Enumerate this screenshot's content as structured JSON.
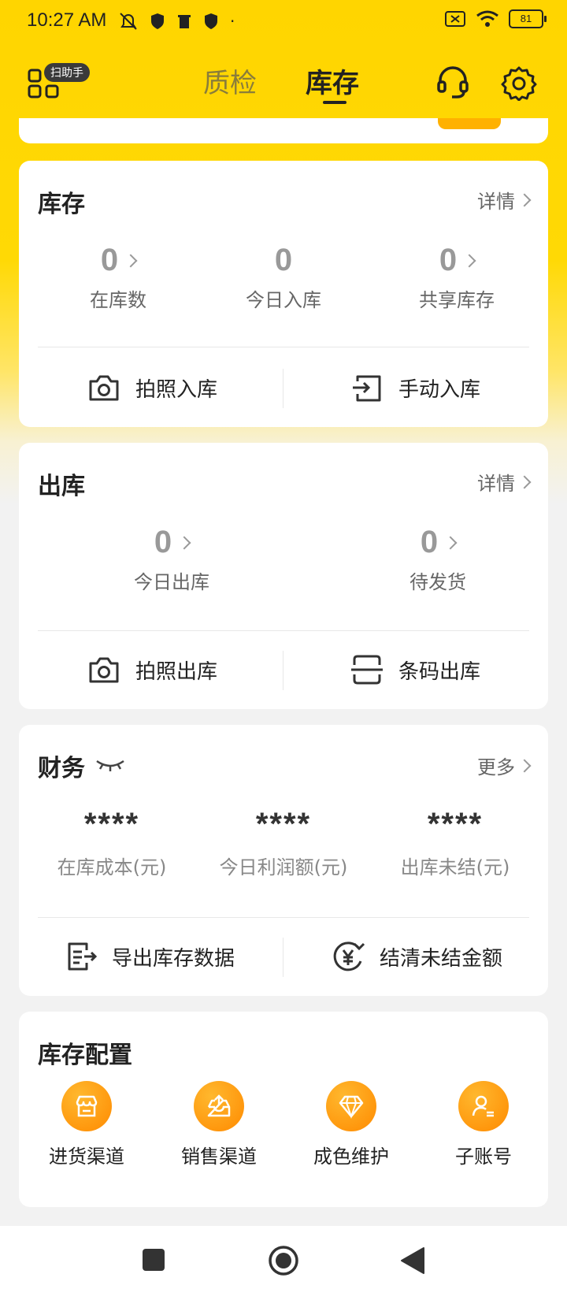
{
  "status_bar": {
    "time": "10:27 AM",
    "battery": "81"
  },
  "header": {
    "scan_badge": "扫助手",
    "tabs": [
      {
        "label": "质检"
      },
      {
        "label": "库存"
      }
    ],
    "active_tab": "库存"
  },
  "inventory_card": {
    "title": "库存",
    "link": "详情",
    "stats": [
      {
        "value": "0",
        "label": "在库数"
      },
      {
        "value": "0",
        "label": "今日入库"
      },
      {
        "value": "0",
        "label": "共享库存"
      }
    ],
    "actions": [
      {
        "label": "拍照入库"
      },
      {
        "label": "手动入库"
      }
    ]
  },
  "outbound_card": {
    "title": "出库",
    "link": "详情",
    "stats": [
      {
        "value": "0",
        "label": "今日出库"
      },
      {
        "value": "0",
        "label": "待发货"
      }
    ],
    "actions": [
      {
        "label": "拍照出库"
      },
      {
        "label": "条码出库"
      }
    ]
  },
  "finance_card": {
    "title": "财务",
    "link": "更多",
    "stats": [
      {
        "value": "****",
        "label": "在库成本(元)"
      },
      {
        "value": "****",
        "label": "今日利润额(元)"
      },
      {
        "value": "****",
        "label": "出库未结(元)"
      }
    ],
    "actions": [
      {
        "label": "导出库存数据"
      },
      {
        "label": "结清未结金额"
      }
    ]
  },
  "config_card": {
    "title": "库存配置",
    "items": [
      {
        "label": "进货渠道",
        "icon": "store-icon"
      },
      {
        "label": "销售渠道",
        "icon": "upload-box-icon"
      },
      {
        "label": "成色维护",
        "icon": "diamond-icon"
      },
      {
        "label": "子账号",
        "icon": "sub-account-icon"
      }
    ]
  },
  "colors": {
    "brand_yellow": "#FFD500",
    "accent_orange": "#FF8A00"
  }
}
